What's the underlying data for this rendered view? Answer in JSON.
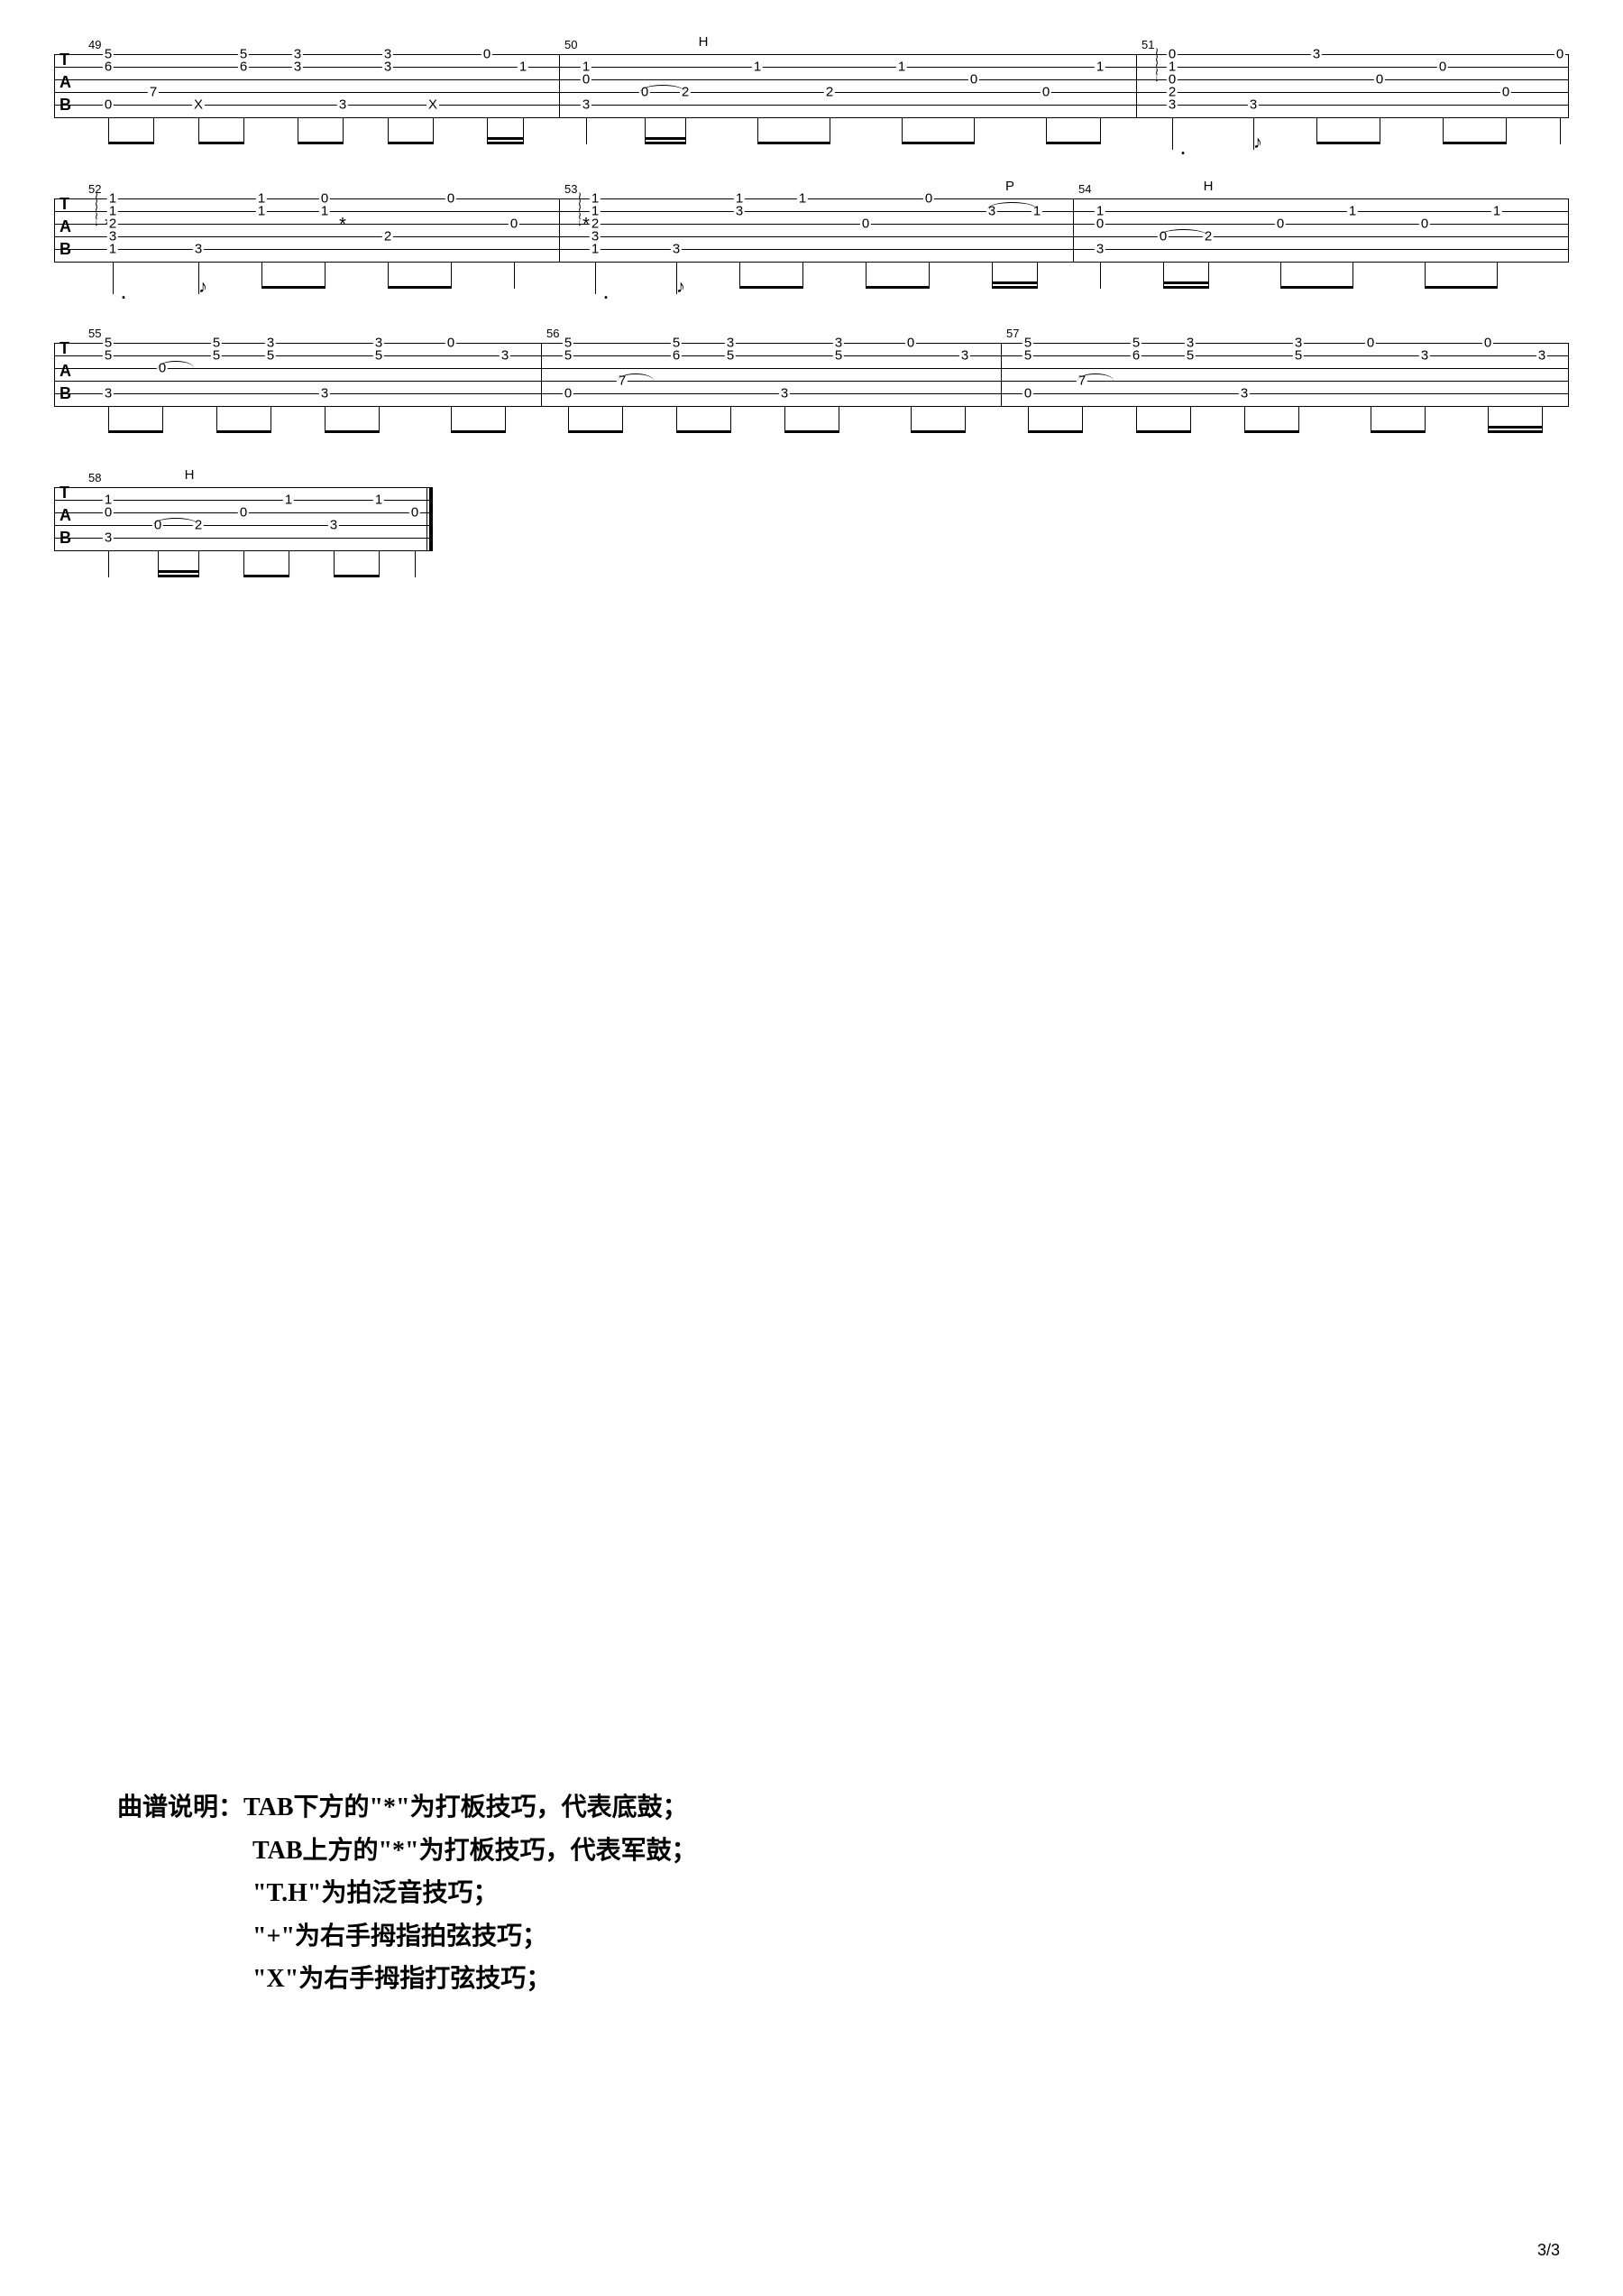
{
  "page_number": "3/3",
  "tab_label": {
    "t": "T",
    "a": "A",
    "b": "B"
  },
  "notes": {
    "heading": "曲谱说明：",
    "line1": "TAB下方的\"*\"为打板技巧，代表底鼓；",
    "line2": "TAB上方的\"*\"为打板技巧，代表军鼓；",
    "line3": "\"T.H\"为拍泛音技巧；",
    "line4": "\"+\"为右手拇指拍弦技巧；",
    "line5": "\"X\"为右手拇指打弦技巧；"
  },
  "measures": {
    "m49": "49",
    "m50": "50",
    "m51": "51",
    "m52": "52",
    "m53": "53",
    "m54": "54",
    "m55": "55",
    "m56": "56",
    "m57": "57",
    "m58": "58"
  },
  "techniques": {
    "H": "H",
    "P": "P"
  },
  "symbols": {
    "asterisk": "*",
    "x": "X",
    "dot": "."
  },
  "chart_data": {
    "type": "guitar_tab",
    "strings": 6,
    "lines": [
      {
        "measures": [
          {
            "num": 49,
            "notes": [
              {
                "pos": 0,
                "frets": {
                  "1": "5",
                  "2": "6",
                  "5": "0"
                }
              },
              {
                "pos": 1,
                "frets": {
                  "4": "7"
                }
              },
              {
                "pos": 2,
                "frets": {
                  "5": "X"
                },
                "below": "*"
              },
              {
                "pos": 3,
                "frets": {
                  "1": "5",
                  "2": "6"
                }
              },
              {
                "pos": 4,
                "frets": {
                  "1": "3",
                  "2": "3"
                }
              },
              {
                "pos": 5,
                "frets": {
                  "5": "3"
                }
              },
              {
                "pos": 6,
                "frets": {
                  "1": "3",
                  "2": "3"
                }
              },
              {
                "pos": 7,
                "frets": {
                  "5": "X"
                },
                "below": "*"
              },
              {
                "pos": 8,
                "frets": {
                  "1": "0"
                }
              },
              {
                "pos": 9,
                "frets": {
                  "2": "1"
                }
              }
            ]
          },
          {
            "num": 50,
            "technique": "H",
            "notes": [
              {
                "pos": 0,
                "frets": {
                  "2": "1",
                  "3": "0",
                  "5": "3"
                },
                "below": "*"
              },
              {
                "pos": 1,
                "frets": {
                  "4": "0",
                  "tie_from": "0"
                }
              },
              {
                "pos": 2,
                "frets": {
                  "4": "2"
                }
              },
              {
                "pos": 3,
                "frets": {
                  "2": "1"
                }
              },
              {
                "pos": 4,
                "frets": {
                  "4": "2"
                }
              },
              {
                "pos": 5,
                "frets": {
                  "2": "1"
                }
              },
              {
                "pos": 6,
                "frets": {
                  "3": "0"
                }
              },
              {
                "pos": 7,
                "frets": {
                  "4": "0"
                }
              },
              {
                "pos": 8,
                "frets": {
                  "2": "1"
                }
              }
            ]
          },
          {
            "num": 51,
            "notes": [
              {
                "pos": 0,
                "arpeggio": true,
                "frets": {
                  "1": "0",
                  "2": "1",
                  "3": "0",
                  "4": "2",
                  "5": "3"
                }
              },
              {
                "pos": 1
              },
              {
                "pos": 2,
                "frets": {
                  "5": "3"
                }
              },
              {
                "pos": 3,
                "frets": {
                  "1": "3"
                }
              },
              {
                "pos": 4,
                "frets": {
                  "3": "0"
                }
              },
              {
                "pos": 5,
                "frets": {
                  "2": "0"
                }
              },
              {
                "pos": 6,
                "frets": {
                  "4": "0"
                }
              },
              {
                "pos": 7,
                "frets": {
                  "1": "0"
                }
              }
            ]
          }
        ]
      },
      {
        "measures": [
          {
            "num": 52,
            "notes": [
              {
                "pos": 0,
                "arpeggio": true,
                "frets": {
                  "1": "1",
                  "2": "1",
                  "3": "2",
                  "4": "3",
                  "5": "1"
                }
              },
              {
                "pos": 1
              },
              {
                "pos": 2,
                "frets": {
                  "5": "3"
                }
              },
              {
                "pos": 3,
                "frets": {
                  "1": "1",
                  "2": "1"
                }
              },
              {
                "pos": 4,
                "frets": {
                  "1": "0",
                  "2": "1"
                }
              },
              {
                "pos": 5,
                "frets": {
                  "4": "2"
                }
              },
              {
                "pos": 6,
                "frets": {
                  "1": "0"
                }
              },
              {
                "pos": 7,
                "frets": {
                  "3": "0"
                }
              }
            ]
          },
          {
            "num": 53,
            "notes": [
              {
                "pos": 0,
                "arpeggio": true,
                "frets": {
                  "1": "1",
                  "2": "1",
                  "3": "2",
                  "4": "3",
                  "5": "1"
                }
              },
              {
                "pos": 1
              },
              {
                "pos": 2,
                "frets": {
                  "5": "3"
                }
              },
              {
                "pos": 3,
                "frets": {
                  "1": "1",
                  "2": "3"
                }
              },
              {
                "pos": 4,
                "frets": {
                  "1": "1"
                }
              },
              {
                "pos": 5,
                "frets": {
                  "3": "0"
                }
              },
              {
                "pos": 6,
                "frets": {
                  "1": "0"
                }
              },
              {
                "pos": 7,
                "frets": {
                  "2": "3"
                },
                "technique": "P"
              },
              {
                "pos": 8,
                "frets": {
                  "2": "1"
                }
              }
            ]
          },
          {
            "num": 54,
            "technique": "H",
            "notes": [
              {
                "pos": 0,
                "frets": {
                  "2": "1",
                  "3": "0",
                  "5": "3"
                }
              },
              {
                "pos": 1,
                "frets": {
                  "4": "0",
                  "tie_from": "0"
                }
              },
              {
                "pos": 2,
                "frets": {
                  "4": "2"
                }
              },
              {
                "pos": 3,
                "frets": {
                  "3": "0"
                }
              },
              {
                "pos": 4,
                "frets": {
                  "2": "1"
                }
              },
              {
                "pos": 5,
                "frets": {
                  "3": "0"
                }
              },
              {
                "pos": 6,
                "frets": {
                  "2": "1"
                }
              }
            ]
          }
        ]
      },
      {
        "measures": [
          {
            "num": 55,
            "notes": [
              {
                "pos": 0,
                "frets": {
                  "1": "5",
                  "2": "5",
                  "5": "3"
                }
              },
              {
                "pos": 1,
                "frets": {
                  "3": "0",
                  "tie_to": true
                }
              },
              {
                "pos": 2,
                "frets": {
                  "1": "5",
                  "2": "5"
                }
              },
              {
                "pos": 3,
                "frets": {
                  "1": "3",
                  "2": "5"
                }
              },
              {
                "pos": 4,
                "frets": {
                  "5": "3"
                }
              },
              {
                "pos": 5,
                "frets": {
                  "1": "3",
                  "2": "5"
                }
              },
              {
                "pos": 6,
                "frets": {
                  "1": "0"
                }
              },
              {
                "pos": 7,
                "frets": {
                  "2": "3"
                }
              }
            ]
          },
          {
            "num": 56,
            "notes": [
              {
                "pos": 0,
                "frets": {
                  "1": "5",
                  "2": "5",
                  "5": "0"
                }
              },
              {
                "pos": 1,
                "frets": {
                  "4": "7",
                  "tie_to": true
                }
              },
              {
                "pos": 2,
                "frets": {
                  "1": "5",
                  "2": "6"
                }
              },
              {
                "pos": 3,
                "frets": {
                  "1": "3",
                  "2": "5"
                }
              },
              {
                "pos": 4,
                "frets": {
                  "5": "3"
                }
              },
              {
                "pos": 5,
                "frets": {
                  "1": "3",
                  "2": "5"
                }
              },
              {
                "pos": 6,
                "frets": {
                  "1": "0"
                }
              },
              {
                "pos": 7,
                "frets": {
                  "2": "3"
                }
              }
            ]
          },
          {
            "num": 57,
            "notes": [
              {
                "pos": 0,
                "frets": {
                  "1": "5",
                  "2": "5",
                  "5": "0"
                }
              },
              {
                "pos": 1,
                "frets": {
                  "4": "7",
                  "tie_to": true
                }
              },
              {
                "pos": 2,
                "frets": {
                  "1": "5",
                  "2": "6"
                }
              },
              {
                "pos": 3,
                "frets": {
                  "1": "3",
                  "2": "5"
                }
              },
              {
                "pos": 4,
                "frets": {
                  "5": "3"
                }
              },
              {
                "pos": 5,
                "frets": {
                  "1": "3",
                  "2": "5"
                }
              },
              {
                "pos": 6,
                "frets": {
                  "1": "0"
                }
              },
              {
                "pos": 7,
                "frets": {
                  "2": "3"
                }
              },
              {
                "pos": 8,
                "frets": {
                  "1": "0"
                }
              },
              {
                "pos": 9,
                "frets": {
                  "2": "3"
                }
              }
            ]
          }
        ]
      },
      {
        "measures": [
          {
            "num": 58,
            "technique": "H",
            "end": true,
            "notes": [
              {
                "pos": 0,
                "frets": {
                  "2": "1",
                  "3": "0",
                  "5": "3"
                }
              },
              {
                "pos": 1,
                "frets": {
                  "4": "0",
                  "tie_from": "0"
                }
              },
              {
                "pos": 2,
                "frets": {
                  "4": "2"
                }
              },
              {
                "pos": 3,
                "frets": {
                  "2": "1"
                }
              },
              {
                "pos": 4,
                "frets": {
                  "4": "3"
                }
              },
              {
                "pos": 5,
                "frets": {
                  "2": "1"
                }
              },
              {
                "pos": 6,
                "frets": {
                  "3": "0"
                }
              }
            ]
          }
        ]
      }
    ]
  }
}
